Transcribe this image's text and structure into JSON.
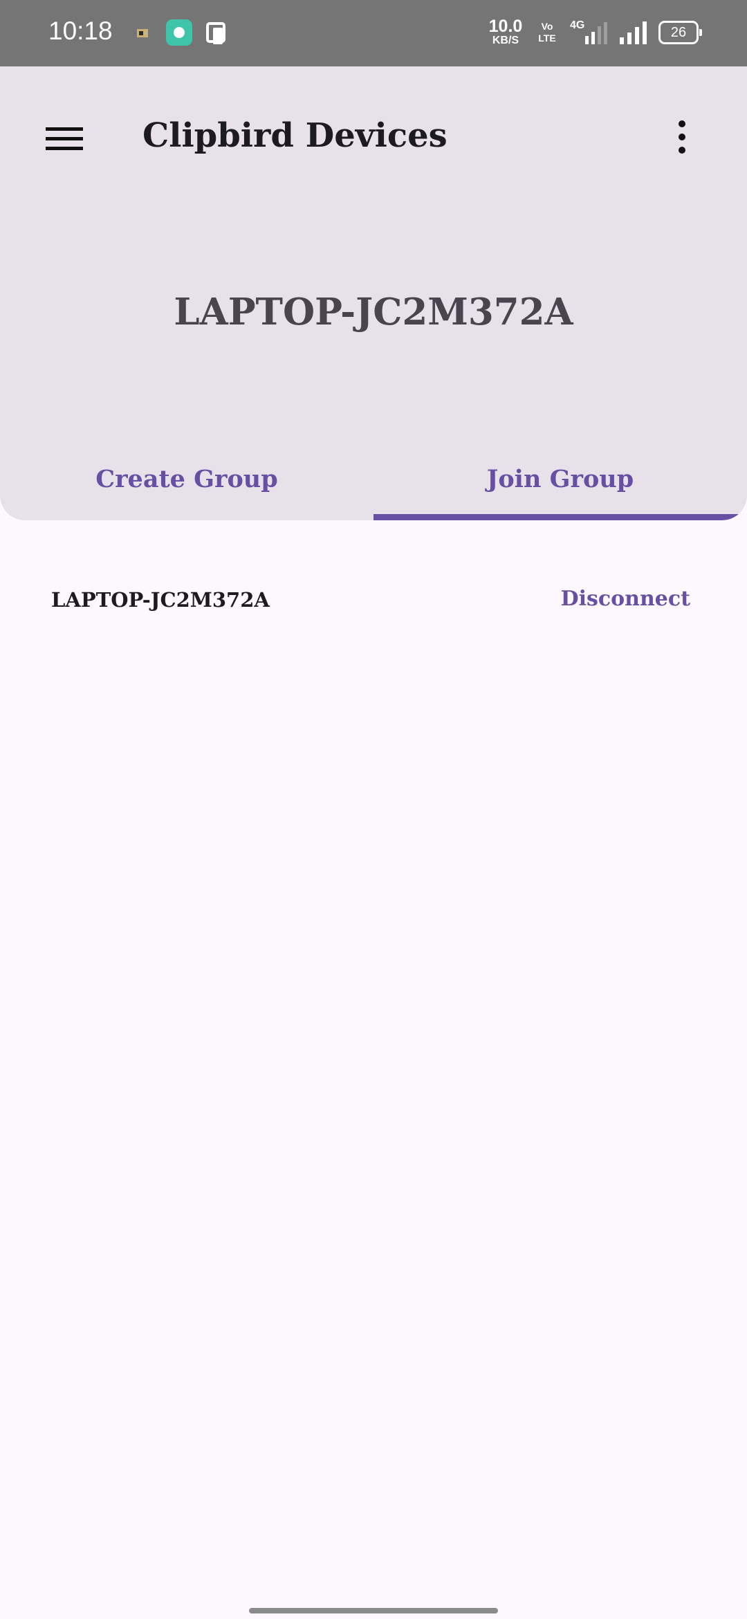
{
  "status_bar": {
    "time": "10:18",
    "net_speed_value": "10.0",
    "net_speed_unit": "KB/S",
    "volte_line1": "Vo",
    "volte_line2": "LTE",
    "network_type": "4G",
    "battery": "26",
    "notification_icons": [
      "app-notification-icon",
      "chat-app-icon",
      "clipboard-app-icon"
    ]
  },
  "app_bar": {
    "title": "Clipbird Devices",
    "menu_icon": "hamburger-menu-icon",
    "overflow_icon": "more-vert-icon"
  },
  "device": {
    "name": "LAPTOP-JC2M372A"
  },
  "tabs": [
    {
      "label": "Create Group",
      "selected": false
    },
    {
      "label": "Join Group",
      "selected": true
    }
  ],
  "connected_devices": [
    {
      "name": "LAPTOP-JC2M372A",
      "action": "Disconnect"
    }
  ],
  "colors": {
    "accent": "#6750a4",
    "header_bg": "#e7e1e9",
    "page_bg": "#fdf8fd",
    "status_bar_bg": "#757575"
  }
}
